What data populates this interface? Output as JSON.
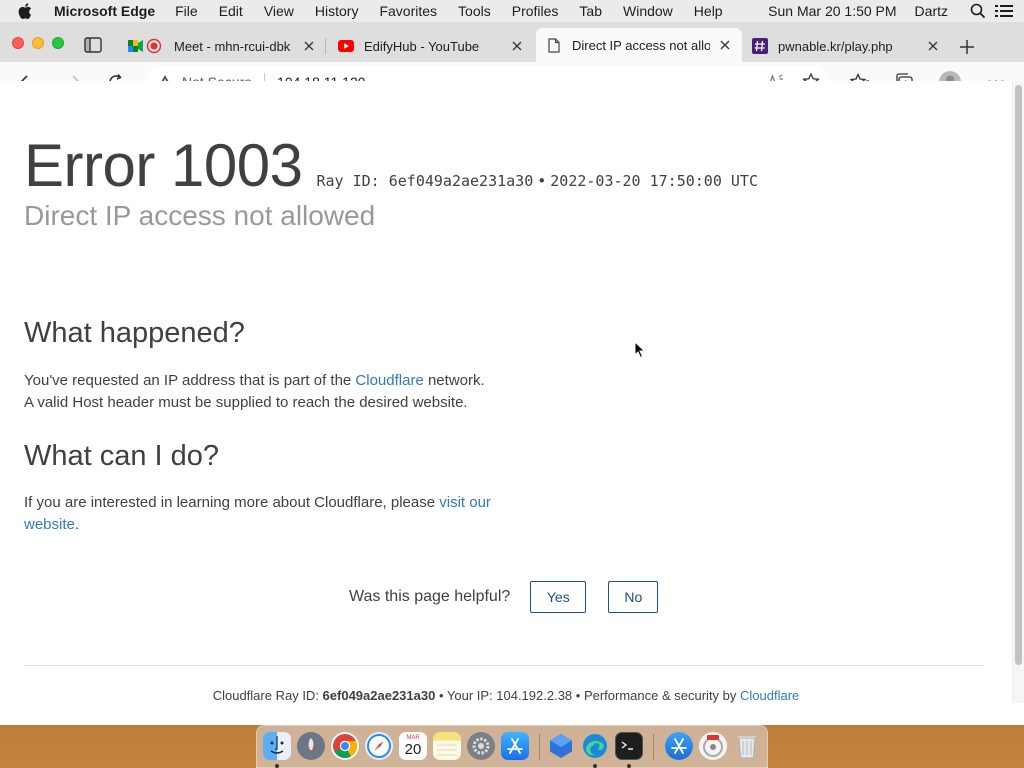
{
  "menubar": {
    "app_name": "Microsoft Edge",
    "menus": [
      "File",
      "Edit",
      "View",
      "History",
      "Favorites",
      "Tools",
      "Profiles",
      "Tab",
      "Window",
      "Help"
    ],
    "clock": "Sun Mar 20  1:50 PM",
    "user": "Dartz"
  },
  "tabs": [
    {
      "label": "Meet - mhn-rcui-dbk",
      "icon": "google-meet-icon",
      "active": false
    },
    {
      "label": "EdifyHub - YouTube",
      "icon": "youtube-icon",
      "active": false
    },
    {
      "label": "Direct IP access not allowed",
      "icon": "page-icon",
      "active": true
    },
    {
      "label": "pwnable.kr/play.php",
      "icon": "hash-icon",
      "active": false
    }
  ],
  "address": {
    "security_text": "Not Secure",
    "url": "104.18.11.120"
  },
  "page": {
    "error_code": "Error 1003",
    "ray_prefix": "Ray ID: 6ef049a2ae231a30",
    "ray_dot": "•",
    "ray_time": "2022-03-20 17:50:00 UTC",
    "subtitle": "Direct IP access not allowed",
    "what_happened": {
      "heading": "What happened?",
      "line1_a": "You've requested an IP address that is part of the ",
      "line1_link": "Cloudflare",
      "line1_b": " network.",
      "line2": "A valid Host header must be supplied to reach the desired website."
    },
    "what_can_i_do": {
      "heading": "What can I do?",
      "text": "If you are interested in learning more about Cloudflare, please ",
      "link": "visit our website",
      "end": "."
    },
    "helpful": {
      "question": "Was this page helpful?",
      "yes": "Yes",
      "no": "No"
    },
    "footer": {
      "ray_label": "Cloudflare Ray ID: ",
      "ray_id": "6ef049a2ae231a30",
      "sep": " • ",
      "ip_label": "Your IP: 104.192.2.38",
      "perf_label": "Performance & security by ",
      "perf_link": "Cloudflare"
    }
  },
  "dock": {
    "apps": [
      "finder",
      "launchpad",
      "chrome",
      "safari",
      "calendar",
      "notes",
      "system-preferences",
      "app-store",
      "sourcetree",
      "edge",
      "terminal",
      "xcode",
      "disk-utility",
      "trash"
    ],
    "calendar_month": "MAR",
    "calendar_day": "20"
  },
  "colors": {
    "link": "#2f7bbf",
    "button_border": "#1a4f8a",
    "subtitle": "#999999"
  }
}
